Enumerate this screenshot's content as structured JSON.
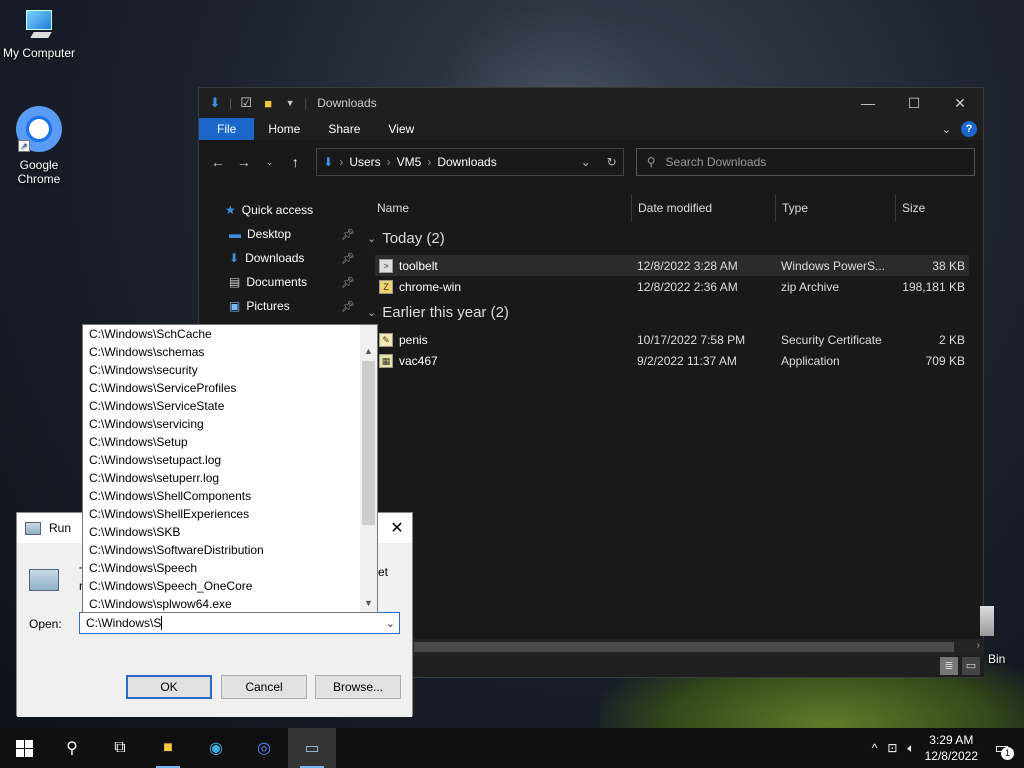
{
  "desktop": {
    "icons": [
      {
        "label": "My Computer"
      },
      {
        "label": "Google Chrome"
      }
    ],
    "recycle_bin_label": "Bin"
  },
  "explorer": {
    "title": "Downloads",
    "ribbon_tabs": [
      "File",
      "Home",
      "Share",
      "View"
    ],
    "breadcrumb": [
      "Users",
      "VM5",
      "Downloads"
    ],
    "search_placeholder": "Search Downloads",
    "nav": {
      "quick_access": "Quick access",
      "items": [
        "Desktop",
        "Downloads",
        "Documents",
        "Pictures"
      ]
    },
    "columns": [
      "Name",
      "Date modified",
      "Type",
      "Size"
    ],
    "groups": [
      {
        "label": "Today (2)",
        "files": [
          {
            "name": "toolbelt",
            "date": "12/8/2022 3:28 AM",
            "type": "Windows PowerS...",
            "size": "38 KB"
          },
          {
            "name": "chrome-win",
            "date": "12/8/2022 2:36 AM",
            "type": "zip Archive",
            "size": "198,181 KB"
          }
        ]
      },
      {
        "label": "Earlier this year (2)",
        "files": [
          {
            "name": "penis",
            "date": "10/17/2022 7:58 PM",
            "type": "Security Certificate",
            "size": "2 KB"
          },
          {
            "name": "vac467",
            "date": "9/2/2022 11:37 AM",
            "type": "Application",
            "size": "709 KB"
          }
        ]
      }
    ]
  },
  "run": {
    "title": "Run",
    "desc_start": "T",
    "desc_end": "et",
    "desc_line2": "r",
    "open_label": "Open:",
    "open_value": "C:\\Windows\\S",
    "buttons": {
      "ok": "OK",
      "cancel": "Cancel",
      "browse": "Browse..."
    },
    "suggestions": [
      "C:\\Windows\\SchCache",
      "C:\\Windows\\schemas",
      "C:\\Windows\\security",
      "C:\\Windows\\ServiceProfiles",
      "C:\\Windows\\ServiceState",
      "C:\\Windows\\servicing",
      "C:\\Windows\\Setup",
      "C:\\Windows\\setupact.log",
      "C:\\Windows\\setuperr.log",
      "C:\\Windows\\ShellComponents",
      "C:\\Windows\\ShellExperiences",
      "C:\\Windows\\SKB",
      "C:\\Windows\\SoftwareDistribution",
      "C:\\Windows\\Speech",
      "C:\\Windows\\Speech_OneCore",
      "C:\\Windows\\splwow64.exe"
    ]
  },
  "taskbar": {
    "time": "3:29 AM",
    "date": "12/8/2022",
    "notification_count": "1"
  }
}
